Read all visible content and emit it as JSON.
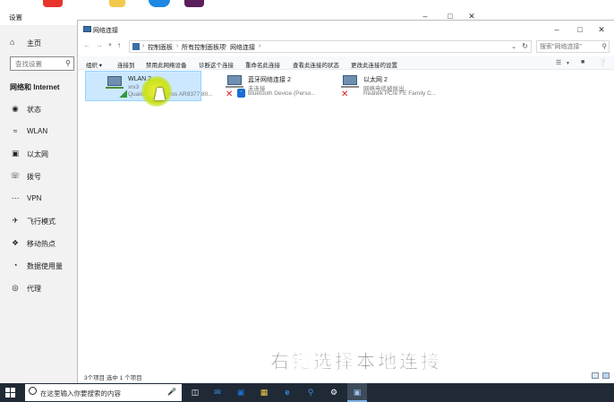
{
  "desktop": {
    "icon_colors": [
      "#e8342a",
      "#f2c94c",
      "#1e88e5",
      "#5a1e5a"
    ]
  },
  "settings": {
    "title": "设置",
    "home_label": "主页",
    "search_placeholder": "查找设置",
    "section": "网络和 Internet",
    "items": [
      {
        "label": "状态",
        "icon": "status-icon"
      },
      {
        "label": "WLAN",
        "icon": "wifi-icon"
      },
      {
        "label": "以太网",
        "icon": "ethernet-icon"
      },
      {
        "label": "拨号",
        "icon": "dialup-icon"
      },
      {
        "label": "VPN",
        "icon": "vpn-icon"
      },
      {
        "label": "飞行模式",
        "icon": "airplane-icon"
      },
      {
        "label": "移动热点",
        "icon": "hotspot-icon"
      },
      {
        "label": "数据使用量",
        "icon": "data-usage-icon"
      },
      {
        "label": "代理",
        "icon": "proxy-icon"
      }
    ]
  },
  "explorer": {
    "title": "网络连接",
    "breadcrumb": [
      "控制面板",
      "所有控制面板项",
      "网络连接"
    ],
    "search_placeholder": "搜索\"网络连接\"",
    "commands": [
      "组织 ▾",
      "连接到",
      "禁用此网络设备",
      "诊断这个连接",
      "重命名此连接",
      "查看此连接的状态",
      "更改此连接的设置"
    ],
    "connections": [
      {
        "name": "WLAN 2",
        "status": "xrx3",
        "device": "Qualcomm Atheros AR9377 80...",
        "selected": true,
        "badge": "signal"
      },
      {
        "name": "蓝牙网络连接 2",
        "status": "未连接",
        "device": "Bluetooth Device (Perso...",
        "selected": false,
        "badge": "bluetooth"
      },
      {
        "name": "以太网 2",
        "status": "网络电缆被拔出",
        "device": "Realtek PCIe FE Family C...",
        "selected": false,
        "badge": "none"
      }
    ],
    "status_left": "3个项目    选中 1 个项目"
  },
  "subtitle": "右键选择本地连接",
  "taskbar": {
    "search_placeholder": "在这里输入你要搜索的内容"
  }
}
